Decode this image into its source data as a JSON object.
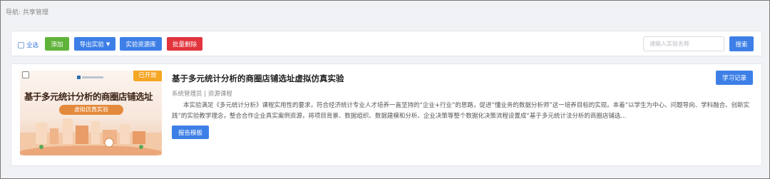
{
  "breadcrumb": {
    "prefix": "导航:",
    "current": "共享管理"
  },
  "toolbar": {
    "select_all_label": "全选",
    "add_label": "添加",
    "export_label": "导出实验",
    "resource_label": "实验资源库",
    "batch_delete_label": "批量删除",
    "search_placeholder": "请输入实验名称",
    "search_label": "搜索"
  },
  "card": {
    "badge": "已开放",
    "thumb_title": "基于多元统计分析的商圈店铺选址",
    "thumb_subtitle": "虚拟仿真实验",
    "title": "基于多元统计分析的商圈店铺选址虚拟仿真实验",
    "meta": "系统管理员 | 资源课程",
    "description": "本实验满足《多元统计分析》课程实用性的要求，符合经济统计专业人才培养一直坚持的“企业+行业”的思路，促进“懂业务的数据分析师”这一培养目标的实现。本着“以学生为中心、问题导向、学科融合、创新实践”的实验教学理念，整合合作企业真实案例资源，将项目背景、数据组织、数据建模和分析、企业决策等整个数据化决策流程设置成“基于多元统计法分析的商圈店铺选...",
    "report_label": "报告模板",
    "record_label": "学习记录"
  },
  "colors": {
    "primary": "#3d7fe6",
    "success": "#5fb33a",
    "danger": "#e2343d",
    "badge": "#f5a623"
  }
}
